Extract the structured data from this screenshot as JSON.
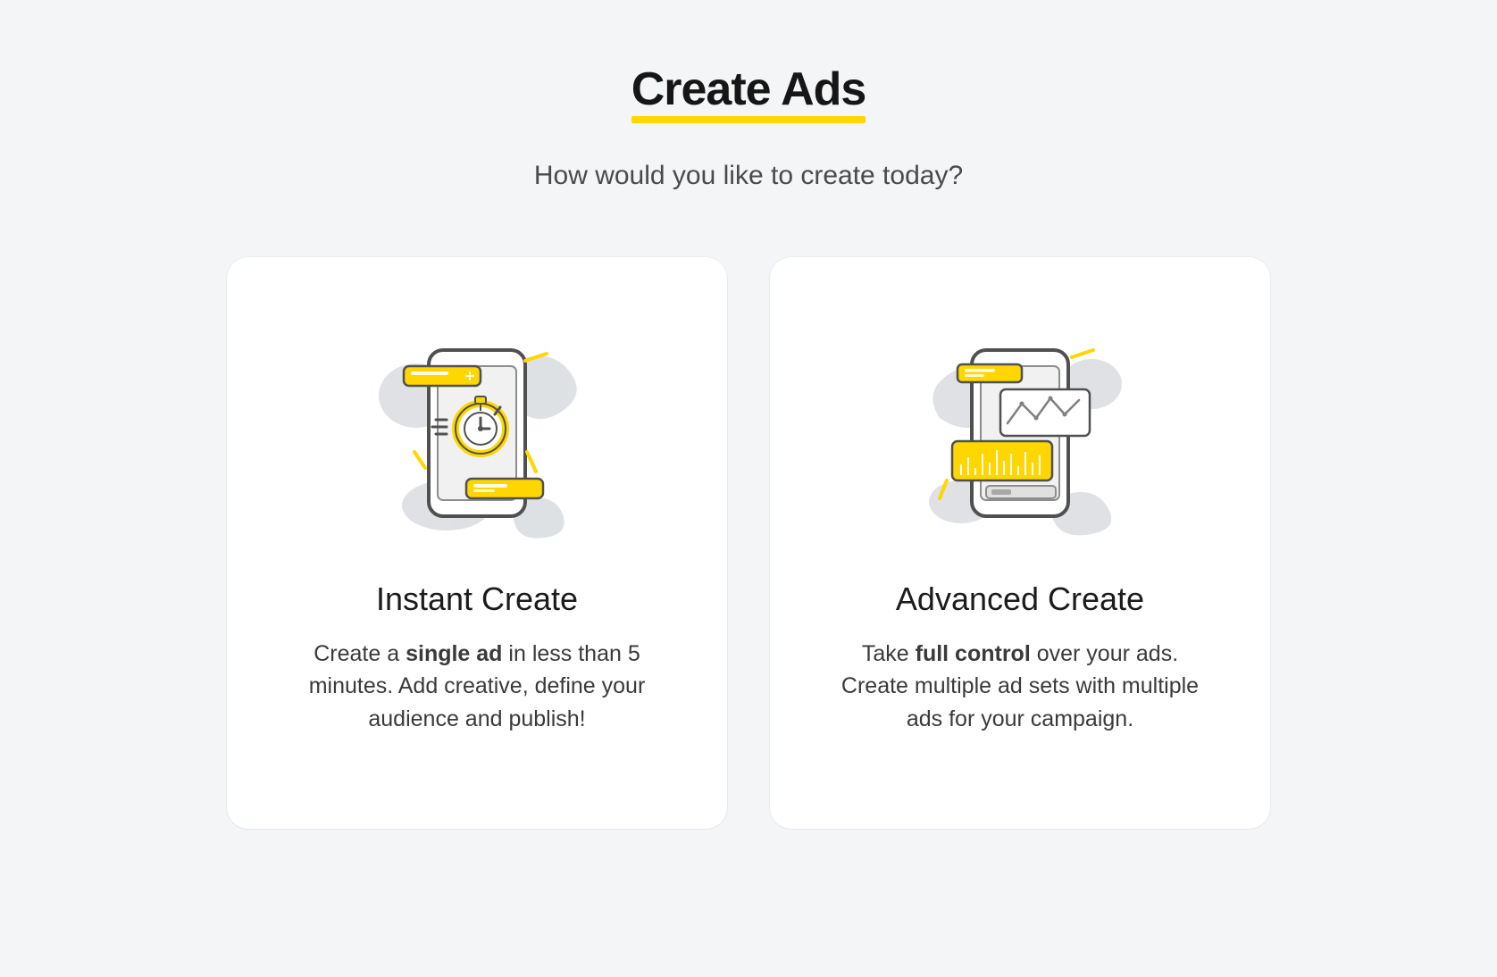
{
  "header": {
    "title": "Create Ads",
    "subtitle": "How would you like to create today?"
  },
  "cards": {
    "instant": {
      "title": "Instant Create",
      "desc_pre": "Create a ",
      "desc_bold": "single ad",
      "desc_post": " in less than 5 minutes. Add creative, define your audience and publish!"
    },
    "advanced": {
      "title": "Advanced Create",
      "desc_pre": "Take ",
      "desc_bold": "full control",
      "desc_post": " over your ads. Create multiple ad sets with multiple ads for your campaign."
    }
  },
  "colors": {
    "accent": "#ffd600",
    "accent_dark": "#f2c200",
    "outline": "#505050",
    "light_gray": "#d9dcdf",
    "bg_gray": "#e6e8ea"
  }
}
